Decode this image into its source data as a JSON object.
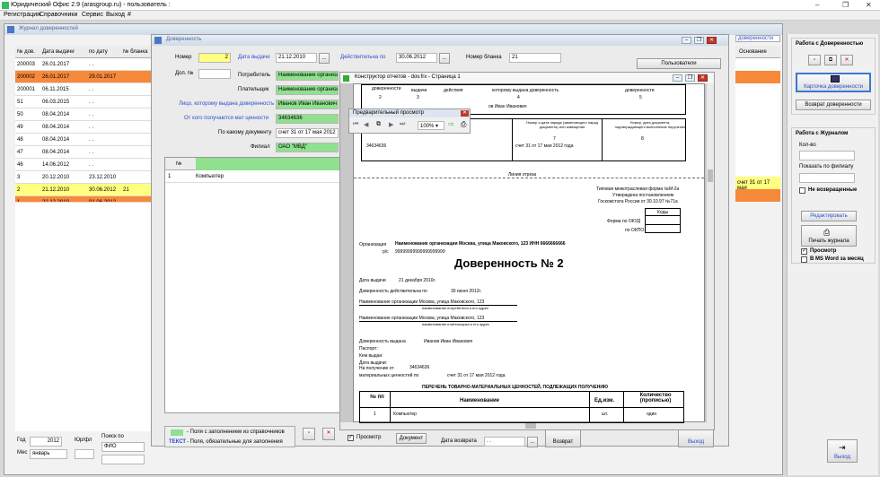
{
  "app": {
    "title": "Юридический Офис 2.9 (arasgroup.ru) - пользователь :"
  },
  "menu": [
    "Регистрация",
    "Справочники",
    "Сервис",
    "Выход",
    "#"
  ],
  "journal": {
    "title": "Журнал доверенностей",
    "columns": [
      "№ дов.",
      "Дата выдачи",
      "по дату",
      "№ бланка"
    ],
    "rows": [
      {
        "num": "200003",
        "date": "26.01.2017",
        "to": ". .",
        "blank": "",
        "hl": ""
      },
      {
        "num": "200002",
        "date": "26.01.2017",
        "to": "29.01.2017",
        "blank": "",
        "hl": "orange"
      },
      {
        "num": "200001",
        "date": "06.11.2015",
        "to": ". .",
        "blank": "",
        "hl": ""
      },
      {
        "num": "51",
        "date": "06.03.2015",
        "to": ". .",
        "blank": "",
        "hl": ""
      },
      {
        "num": "50",
        "date": "08.04.2014",
        "to": ". .",
        "blank": "",
        "hl": ""
      },
      {
        "num": "49",
        "date": "08.04.2014",
        "to": ". .",
        "blank": "",
        "hl": ""
      },
      {
        "num": "48",
        "date": "08.04.2014",
        "to": ". .",
        "blank": "",
        "hl": ""
      },
      {
        "num": "47",
        "date": "08.04.2014",
        "to": ". .",
        "blank": "",
        "hl": ""
      },
      {
        "num": "46",
        "date": "14.06.2012",
        "to": ". .",
        "blank": "",
        "hl": ""
      },
      {
        "num": "3",
        "date": "20.12.2010",
        "to": "23.12.2010",
        "blank": "",
        "hl": ""
      },
      {
        "num": "2",
        "date": "21.12.2010",
        "to": "30.06.2012",
        "blank": "21",
        "hl": "yellow"
      },
      {
        "num": "1",
        "date": "22.12.2010",
        "to": "01.06.2012",
        "blank": "",
        "hl": "orange"
      }
    ],
    "right_header": "доверенности",
    "right_col": "Основание",
    "right_cell": "счет 31 от 17 мая",
    "filters": {
      "year_label": "Год",
      "year": "2012",
      "month_label": "Мес",
      "month": "январь",
      "yurl_label": "Юр/фл",
      "search_label": "Поиск по",
      "search_value": "ФИО"
    }
  },
  "proxy_form": {
    "title": "Доверенность",
    "number_label": "Номер",
    "number": "2",
    "issue_date_label": "Дата выдачи",
    "issue_date": "21.12.2010",
    "valid_label": "Действительна по",
    "valid_date": "30.06.2012",
    "blank_label": "Номер бланка",
    "blank": "21",
    "users_btn": "Пользователи",
    "extra_label": "Доп. №",
    "consumer_label": "Потребитель",
    "consumer": "Наименование организа",
    "payer_label": "Плательщик",
    "payer": "Наименование организа",
    "person_label": "Лицо, которому выдана доверенность",
    "person": "Иванов Иван Иванович",
    "from_label": "От кого получаются мат ценности",
    "from": "34634636",
    "doc_label": "По какому документу",
    "doc": "счет 31 от 17 мая 2012",
    "branch_label": "Филиал",
    "branch": "ОАО \"МВД\"",
    "table_header": "№",
    "table_row_num": "1",
    "table_row_item": "Компьютер",
    "legend_green": "- Поля с заполнением из справочников",
    "legend_text_key": "ТЕКСТ",
    "legend_text": "- Поля, обязательные для заполнения",
    "preview_chk": "Просмотр",
    "document_btn": "Документ",
    "return_date_label": "Дата возврата",
    "return_date": ". .",
    "return_btn": "Возврат",
    "exit_btn": "Выход"
  },
  "constructor": {
    "title": "Конструктор отчетов - dov.frx - Страница 1"
  },
  "preview_toolbar": {
    "title": "Предварительный просмотр",
    "zoom": "100%"
  },
  "document": {
    "top_headers": [
      "доверенности",
      "выдачи",
      "действия",
      "которому выдана доверенность",
      "доверенности"
    ],
    "top_nums": [
      "2",
      "3",
      "4",
      "5"
    ],
    "top_name": "ов Иван Иванович",
    "mid_headers": [
      "Номер и дата наряда (заменяющего наряд документа) или извещения",
      "Номер, дата документа, подтверждающего выполнение поручения"
    ],
    "mid_nums": [
      "7",
      "8"
    ],
    "mid_cells": [
      "34634636",
      "счет 31 от 17 мая 2012 года"
    ],
    "cut_line": "Линия отреза",
    "form_lines": [
      "Типовая межотраслевая форма №М-2а",
      "Утверждена постановлением",
      "Госкомстата России от 30.10.97 №71а"
    ],
    "codes_header": "Коды",
    "okud_label": "Форма по ОКУД",
    "okpo_label": "по ОКПО",
    "org_label": "Организация",
    "org_value": "Наименование организации  Москва, улица Маковского, 123   ИНН 6666666666",
    "rs_label": "р/с",
    "rs_value": "99999999999999999999",
    "heading": "Доверенность  №  2",
    "issue_label": "Дата выдачи",
    "issue_value": "21 декабря 2010г.",
    "valid_label": "Доверенность действительна по",
    "valid_value": "30 июня 2012г.",
    "consumer_line": "Наименование организации   Москва, улица Маковского, 123",
    "consumer_caption": "наименование потребителя и его адрес",
    "payer_line": "Наименование организации   Москва, улица Маковского, 123",
    "payer_caption": "наименование плательщика и его адрес",
    "issued_label": "Доверенность выдана",
    "issued_value": "Иванов Иван Иванович",
    "passport_label": "Паспорт:",
    "who_label": "Кем выдан:",
    "when_label": "Дата выдачи:",
    "receive_label": "На получение от",
    "receive_value": "34634636",
    "valuables_label": "материальных ценностей по",
    "valuables_value": "счет 31 от 17 мая 2012 года",
    "list_title": "ПЕРЕЧЕНЬ ТОВАРНО-МАТЕРИАЛЬНЫХ ЦЕННОСТЕЙ, ПОДЛЕЖАЩИХ ПОЛУЧЕНИЮ",
    "list_cols": [
      "№ пп",
      "Наименование",
      "Ед.изм.",
      "Количество (прописью)"
    ],
    "list_row": [
      "1",
      "Компьютер",
      "шт.",
      "один"
    ]
  },
  "right_panel": {
    "section1": "Работа с Доверенностью",
    "card_btn": "Карточка доверенности",
    "return_btn": "Возврат доверенности",
    "section2": "Работа с Журналом",
    "count_label": "Кол-во",
    "branch_filter_label": "Показать по филиалу",
    "not_returned": "Не возвращенные",
    "edit_btn": "Редактировать",
    "print_btn": "Печать журнала",
    "preview_chk": "Просмотр",
    "word_chk": "В MS Word за месяц",
    "exit_btn": "Выход"
  },
  "colors": {
    "orange": "#f7893a",
    "yellow": "#ffff80",
    "green": "#8fe08f",
    "link_blue": "#2a4fcf"
  }
}
